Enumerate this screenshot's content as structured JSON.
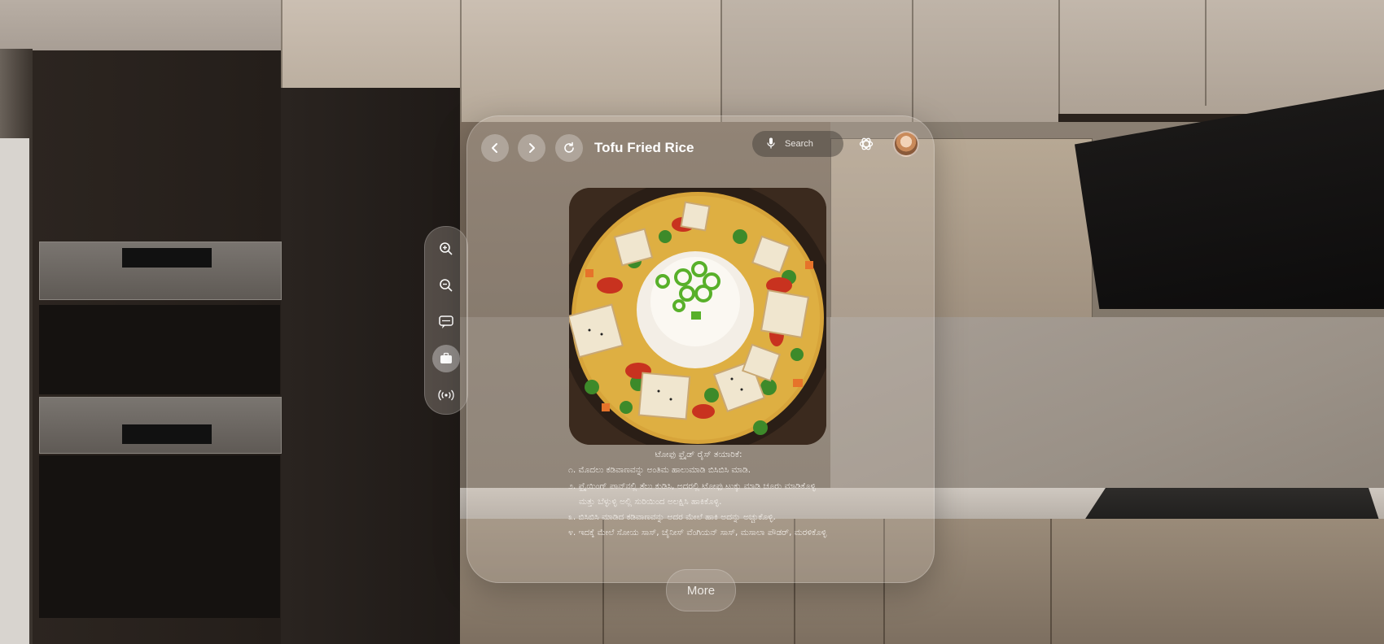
{
  "window": {
    "title": "Tofu Fried Rice",
    "search": {
      "label": "Search"
    }
  },
  "recipe": {
    "heading": "ಟೋಫು ಫ್ರೈಡ್ ರೈಸ್ ತಯಾರಿಕೆ:",
    "steps": [
      "೧. ಮೊದಲು ಕಡಿವಾಣವನ್ನು ಅಂತಿಮ ಹಾಲುಮಾಡಿ ಬಿಸಿಬಿಸಿ ಮಾಡಿ.",
      "೨. ಫ್ರೈಯಿಂಗ್ ಪಾನ್‌ನಲ್ಲಿ ತೆಲು ಕುಡಿಸಿ, ಅದರಲ್ಲಿ ಟೋಫು ಟುಕ್ಕು ಮಾಡಿ ಚೂರು ಮಾಡಿಕೊಳ್ಳಿ",
      "ಮತ್ತು ಬೆಳ್ಳುಳ್ಳಿ ಅಲ್ಲಿ ಸುರಿಯಿಂದ ಅಲಕ್ಷಿಸಿ ಹಾಕಿಕೊಳ್ಳಿ.",
      "೩. ಬಿಸಿಬಿಸಿ ಮಾಡಿದ ಕಡಿವಾಣವನ್ನು ಅದರ ಮೇಲೆ ಹಾಕಿ ಅದನ್ನು ಅಚ್ಚುಕೊಳ್ಳಿ.",
      "೪. ಇದಕ್ಕೆ ಮೇಲೆ ಸೋಯ ಸಾಸ್, ಚೈನೀಸ್ ವೆಂಗಿಯನ್ ಸಾಸ್, ಮಸಾಲಾ ಪೌಡರ್, ಮರಳಿಕೊಳ್ಳಿ"
    ]
  },
  "toolbar": {
    "tools": [
      "zoom-in-icon",
      "zoom-out-icon",
      "subtitles-icon",
      "briefcase-icon",
      "broadcast-icon"
    ],
    "active_tool": "briefcase-icon"
  },
  "more_label": "More",
  "colors": {
    "glass": "#c8beb4",
    "text": "#ffffff"
  }
}
